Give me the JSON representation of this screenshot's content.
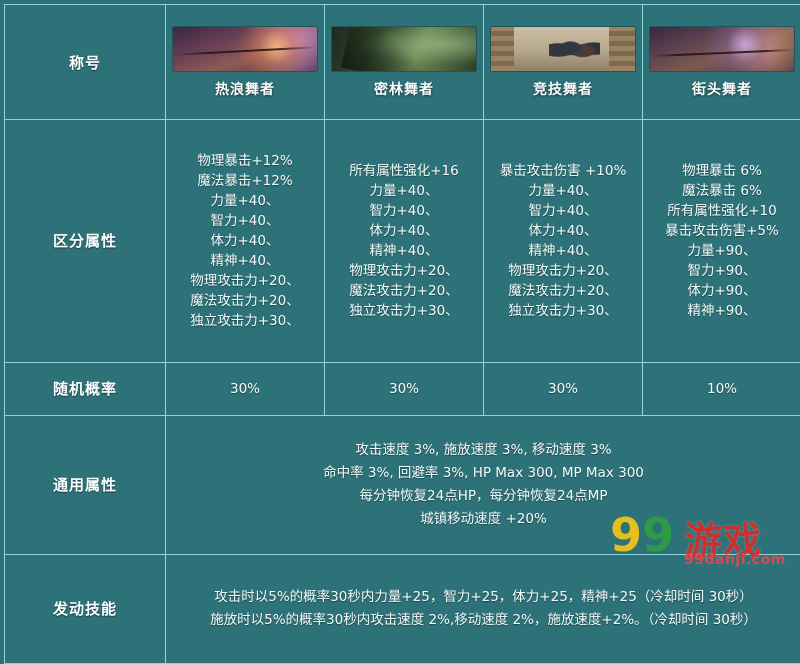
{
  "table": {
    "rows": {
      "title_label": "称号",
      "attribute_label": "区分属性",
      "probability_label": "随机概率",
      "common_label": "通用属性",
      "skill_label": "发动技能"
    },
    "titles": [
      {
        "name": "热浪舞者",
        "thumb": "heat-wave-dancer-thumb"
      },
      {
        "name": "密林舞者",
        "thumb": "dense-forest-dancer-thumb"
      },
      {
        "name": "竞技舞者",
        "thumb": "arena-dancer-thumb"
      },
      {
        "name": "街头舞者",
        "thumb": "street-dancer-thumb"
      }
    ],
    "attributes": [
      "物理暴击+12%\n魔法暴击+12%\n力量+40、\n智力+40、\n体力+40、\n精神+40、\n物理攻击力+20、\n魔法攻击力+20、\n独立攻击力+30、",
      "所有属性强化+16\n力量+40、\n智力+40、\n体力+40、\n精神+40、\n物理攻击力+20、\n魔法攻击力+20、\n独立攻击力+30、",
      "暴击攻击伤害 +10%\n力量+40、\n智力+40、\n体力+40、\n精神+40、\n物理攻击力+20、\n魔法攻击力+20、\n独立攻击力+30、",
      "物理暴击 6%\n魔法暴击 6%\n所有属性强化+10\n暴击攻击伤害+5%\n力量+90、\n智力+90、\n体力+90、\n精神+90、"
    ],
    "probabilities": [
      "30%",
      "30%",
      "30%",
      "10%"
    ],
    "common_attributes": "攻击速度 3%, 施放速度 3%, 移动速度 3%\n命中率 3%, 回避率 3%, HP Max 300, MP Max 300\n每分钟恢复24点HP，每分钟恢复24点MP\n城镇移动速度 +20%",
    "skill_effect": "攻击时以5%的概率30秒内力量+25，智力+25，体力+25，精神+25（冷却时间 30秒）\n施放时以5%的概率30秒内攻击速度 2%,移动速度 2%，施放速度+2%。（冷却时间 30秒）"
  },
  "watermark": {
    "nine_first": "9",
    "nine_second": "9",
    "cn_text": "游戏",
    "domain": "99danji.com"
  },
  "colors": {
    "background": "#2d7278",
    "border": "#8fd4d6",
    "text": "#f6fdfd",
    "watermark_red": "#d92b2b",
    "watermark_yellow": "#f5c518",
    "watermark_green": "#2f9e44"
  }
}
